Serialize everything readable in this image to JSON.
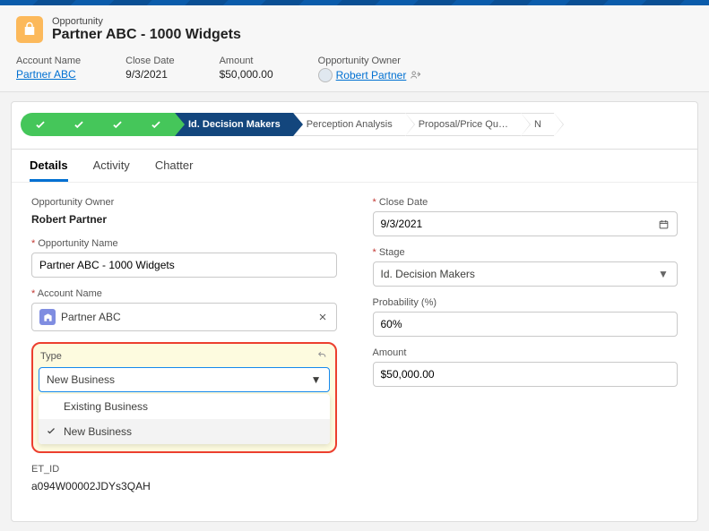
{
  "header": {
    "object_label": "Opportunity",
    "title": "Partner ABC - 1000 Widgets",
    "fields": {
      "account_name": {
        "label": "Account Name",
        "value": "Partner ABC"
      },
      "close_date": {
        "label": "Close Date",
        "value": "9/3/2021"
      },
      "amount": {
        "label": "Amount",
        "value": "$50,000.00"
      },
      "owner": {
        "label": "Opportunity Owner",
        "value": "Robert Partner"
      }
    }
  },
  "path": {
    "current": "Id. Decision Makers",
    "future": [
      "Perception Analysis",
      "Proposal/Price Qu…",
      "N"
    ]
  },
  "tabs": [
    "Details",
    "Activity",
    "Chatter"
  ],
  "details": {
    "owner": {
      "label": "Opportunity Owner",
      "value": "Robert Partner"
    },
    "opp_name": {
      "label": "Opportunity Name",
      "value": "Partner ABC - 1000 Widgets"
    },
    "account": {
      "label": "Account Name",
      "value": "Partner ABC"
    },
    "type": {
      "label": "Type",
      "value": "New Business",
      "options": [
        "Existing Business",
        "New Business"
      ]
    },
    "et_id": {
      "label": "ET_ID",
      "value": "a094W00002JDYs3QAH"
    },
    "close_date": {
      "label": "Close Date",
      "value": "9/3/2021"
    },
    "stage": {
      "label": "Stage",
      "value": "Id. Decision Makers"
    },
    "probability": {
      "label": "Probability (%)",
      "value": "60%"
    },
    "amount": {
      "label": "Amount",
      "value": "$50,000.00"
    }
  }
}
